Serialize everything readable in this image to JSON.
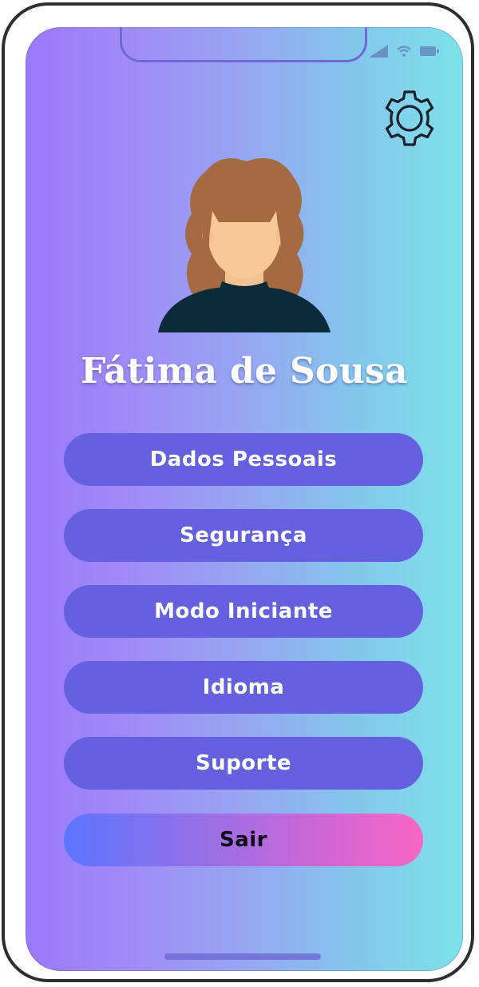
{
  "profile": {
    "name": "Fátima de Sousa"
  },
  "menu": {
    "items": [
      {
        "label": "Dados Pessoais"
      },
      {
        "label": "Segurança"
      },
      {
        "label": "Modo Iniciante"
      },
      {
        "label": "Idioma"
      },
      {
        "label": "Suporte"
      }
    ],
    "logout_label": "Sair"
  },
  "icons": {
    "settings": "gear-icon",
    "signal": "signal-icon",
    "wifi": "wifi-icon",
    "battery": "battery-icon"
  },
  "colors": {
    "background_start": "#9b79fb",
    "background_end": "#7de2ea",
    "button": "#6460e0",
    "logout_start": "#5a75ff",
    "logout_end": "#f866c6",
    "name_text": "#ffffff"
  }
}
